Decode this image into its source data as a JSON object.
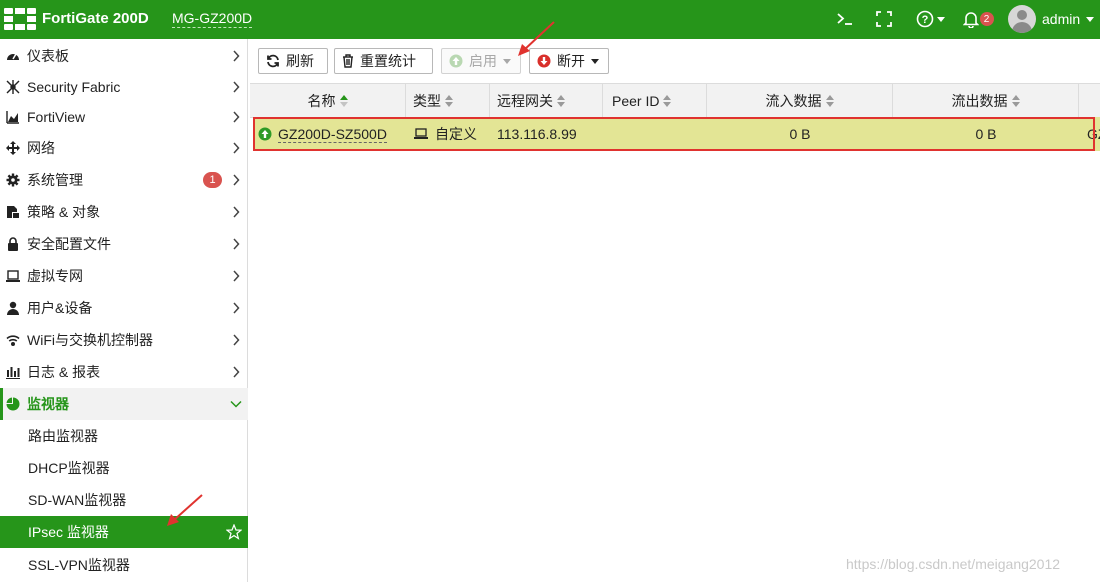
{
  "header": {
    "brand": "FortiGate 200D",
    "hostname": "MG-GZ200D",
    "notification_count": "2",
    "username": "admin",
    "icons": [
      "fortinet-logo-icon",
      "cli-console-icon",
      "fullscreen-icon",
      "help-icon",
      "bell-icon",
      "user-avatar-icon"
    ]
  },
  "sidebar": {
    "items": [
      {
        "label": "仪表板",
        "icon": "dashboard-icon"
      },
      {
        "label": "Security Fabric",
        "icon": "security-fabric-icon"
      },
      {
        "label": "FortiView",
        "icon": "fortiview-icon"
      },
      {
        "label": "网络",
        "icon": "network-icon"
      },
      {
        "label": "系统管理",
        "icon": "gear-icon",
        "badge": "1"
      },
      {
        "label": "策略 & 对象",
        "icon": "policy-icon"
      },
      {
        "label": "安全配置文件",
        "icon": "lock-icon"
      },
      {
        "label": "虚拟专网",
        "icon": "laptop-icon"
      },
      {
        "label": "用户&设备",
        "icon": "user-icon"
      },
      {
        "label": "WiFi与交换机控制器",
        "icon": "wifi-icon"
      },
      {
        "label": "日志 & 报表",
        "icon": "bar-chart-icon"
      }
    ],
    "monitor_group": {
      "label": "监视器",
      "icon": "pie-chart-icon"
    },
    "monitor_items": [
      {
        "label": "路由监视器"
      },
      {
        "label": "DHCP监视器"
      },
      {
        "label": "SD-WAN监视器"
      },
      {
        "label": "IPsec 监视器",
        "active": true
      },
      {
        "label": "SSL-VPN监视器"
      }
    ]
  },
  "toolbar": {
    "refresh_label": "刷新",
    "reset_stats_label": "重置统计",
    "enable_label": "启用",
    "disconnect_label": "断开"
  },
  "table": {
    "columns": [
      "名称",
      "类型",
      "远程网关",
      "Peer ID",
      "流入数据",
      "流出数据"
    ],
    "rows": [
      {
        "name": "GZ200D-SZ500D",
        "status": "up",
        "type": "自定义",
        "remote_gateway": "113.116.8.99",
        "peer_id": "",
        "incoming": "0 B",
        "outgoing": "0 B",
        "overflow": "GZ"
      }
    ]
  },
  "colors": {
    "brand_green": "#26951a",
    "row_highlight": "#e3e595",
    "annotation_red": "#e0332f",
    "badge_red": "#d9534f"
  },
  "watermark": "https://blog.csdn.net/meigang2012"
}
